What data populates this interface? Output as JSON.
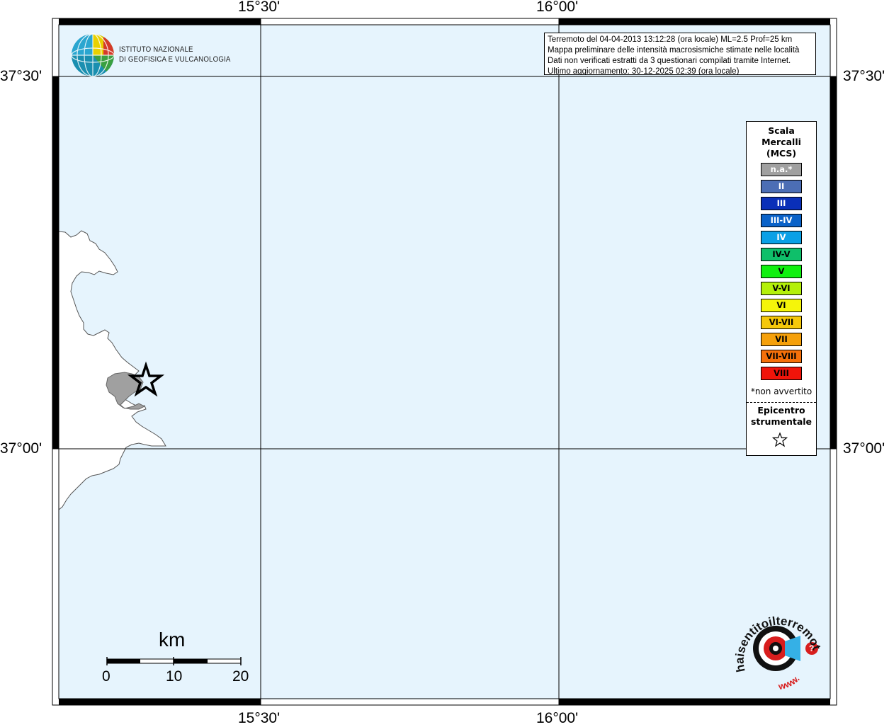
{
  "map": {
    "ticks_top": [
      "15°30'",
      "16°00'"
    ],
    "ticks_bottom": [
      "15°30'",
      "16°00'"
    ],
    "ticks_left": [
      "37°30'",
      "37°00'"
    ],
    "ticks_right": [
      "37°30'",
      "37°00'"
    ],
    "water_color": "#e6f4fd",
    "land_color": "#ffffff",
    "affected_area_color": "#a0a0a0"
  },
  "institute": {
    "name_line1": "ISTITUTO NAZIONALE",
    "name_line2": "DI GEOFISICA E VULCANOLOGIA"
  },
  "info": {
    "line1": "Terremoto del 04-04-2013 13:12:28 (ora locale) ML=2.5 Prof=25 km",
    "line2": "Mappa preliminare delle intensità macrosismiche stimate nelle località",
    "line3": "Dati non verificati estratti da 3 questionari compilati tramite Internet.",
    "line4": "Ultimo aggiornamento: 30-12-2025 02:39 (ora locale)"
  },
  "legend": {
    "title1": "Scala",
    "title2": "Mercalli",
    "title3": "(MCS)",
    "items": [
      {
        "label": "n.a.*",
        "color": "#a0a0a0",
        "text_color": "#ffffff"
      },
      {
        "label": "II",
        "color": "#4c6eb5",
        "text_color": "#ffffff"
      },
      {
        "label": "III",
        "color": "#0a2fb8",
        "text_color": "#ffffff"
      },
      {
        "label": "III-IV",
        "color": "#0a62c8",
        "text_color": "#ffffff"
      },
      {
        "label": "IV",
        "color": "#0aa0e6",
        "text_color": "#ffffff"
      },
      {
        "label": "IV-V",
        "color": "#0fbf6a",
        "text_color": "#000000"
      },
      {
        "label": "V",
        "color": "#0ff00f",
        "text_color": "#000000"
      },
      {
        "label": "V-VI",
        "color": "#b4f00a",
        "text_color": "#000000"
      },
      {
        "label": "VI",
        "color": "#f5f50a",
        "text_color": "#000000"
      },
      {
        "label": "VI-VII",
        "color": "#f5c80a",
        "text_color": "#000000"
      },
      {
        "label": "VII",
        "color": "#f5a00a",
        "text_color": "#000000"
      },
      {
        "label": "VII-VIII",
        "color": "#f5700a",
        "text_color": "#000000"
      },
      {
        "label": "VIII",
        "color": "#f0140a",
        "text_color": "#000000"
      }
    ],
    "note": "*non avvertito",
    "epicenter1": "Epicentro",
    "epicenter2": "strumentale"
  },
  "scale_bar": {
    "unit": "km",
    "labels": [
      "0",
      "10",
      "20"
    ]
  },
  "badge": {
    "text_top": "haisentitoilterremoto.it",
    "text_bottom": "www.",
    "question": "?"
  }
}
